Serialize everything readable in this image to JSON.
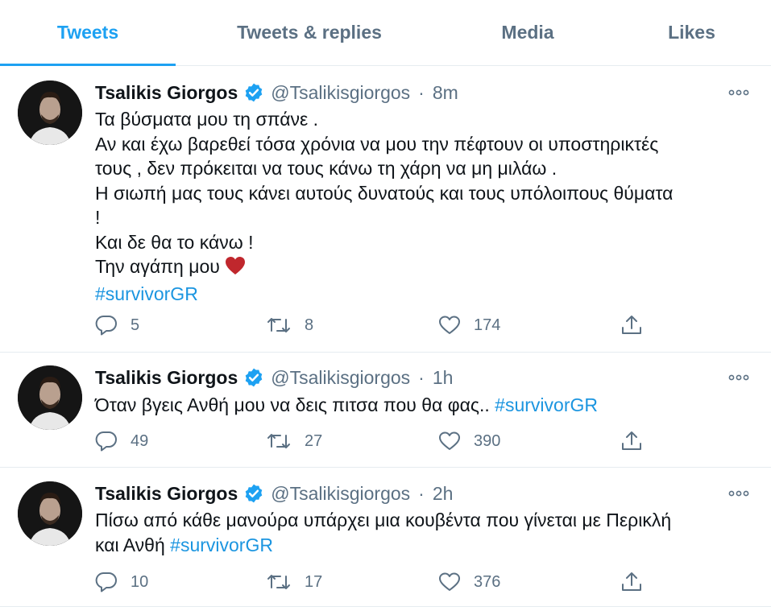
{
  "tabs": [
    {
      "label": "Tweets",
      "active": true
    },
    {
      "label": "Tweets & replies",
      "active": false
    },
    {
      "label": "Media",
      "active": false
    },
    {
      "label": "Likes",
      "active": false
    }
  ],
  "colors": {
    "accent": "#1da1f2",
    "hashtag": "#1b95e0",
    "secondary_text": "#5b7083",
    "heart_emoji": "#c0272d"
  },
  "icons": [
    "verified-badge-icon",
    "more-icon",
    "reply-icon",
    "retweet-icon",
    "like-icon",
    "share-icon",
    "red-heart-emoji"
  ],
  "tweets": [
    {
      "name": "Tsalikis Giorgos",
      "handle": "@Tsalikisgiorgos",
      "separator": "·",
      "time": "8m",
      "lines": [
        "Τα βύσματα μου τη σπάνε .",
        "Αν και έχω βαρεθεί τόσα χρόνια να μου την πέφτουν οι υποστηρικτές",
        "τους , δεν πρόκειται να τους κάνω τη χάρη να μη μιλάω .",
        "Η σιωπή μας τους κάνει αυτούς  δυνατούς και τους υπόλοιπους θύματα",
        "!",
        "Και δε θα το κάνω !",
        "Την αγάπη μου"
      ],
      "hashtag": "#survivorGR",
      "replies": "5",
      "retweets": "8",
      "likes": "174"
    },
    {
      "name": "Tsalikis Giorgos",
      "handle": "@Tsalikisgiorgos",
      "separator": "·",
      "time": "1h",
      "text": "Όταν βγεις Ανθή μου να δεις πιτσα που θα φας..",
      "hashtag": "#survivorGR",
      "replies": "49",
      "retweets": "27",
      "likes": "390"
    },
    {
      "name": "Tsalikis Giorgos",
      "handle": "@Tsalikisgiorgos",
      "separator": "·",
      "time": "2h",
      "line1": "Πίσω από κάθε μανούρα υπάρχει  μια κουβέντα που γίνεται με Περικλή",
      "line2": "και Ανθή",
      "hashtag": "#survivorGR",
      "replies": "10",
      "retweets": "17",
      "likes": "376"
    }
  ]
}
